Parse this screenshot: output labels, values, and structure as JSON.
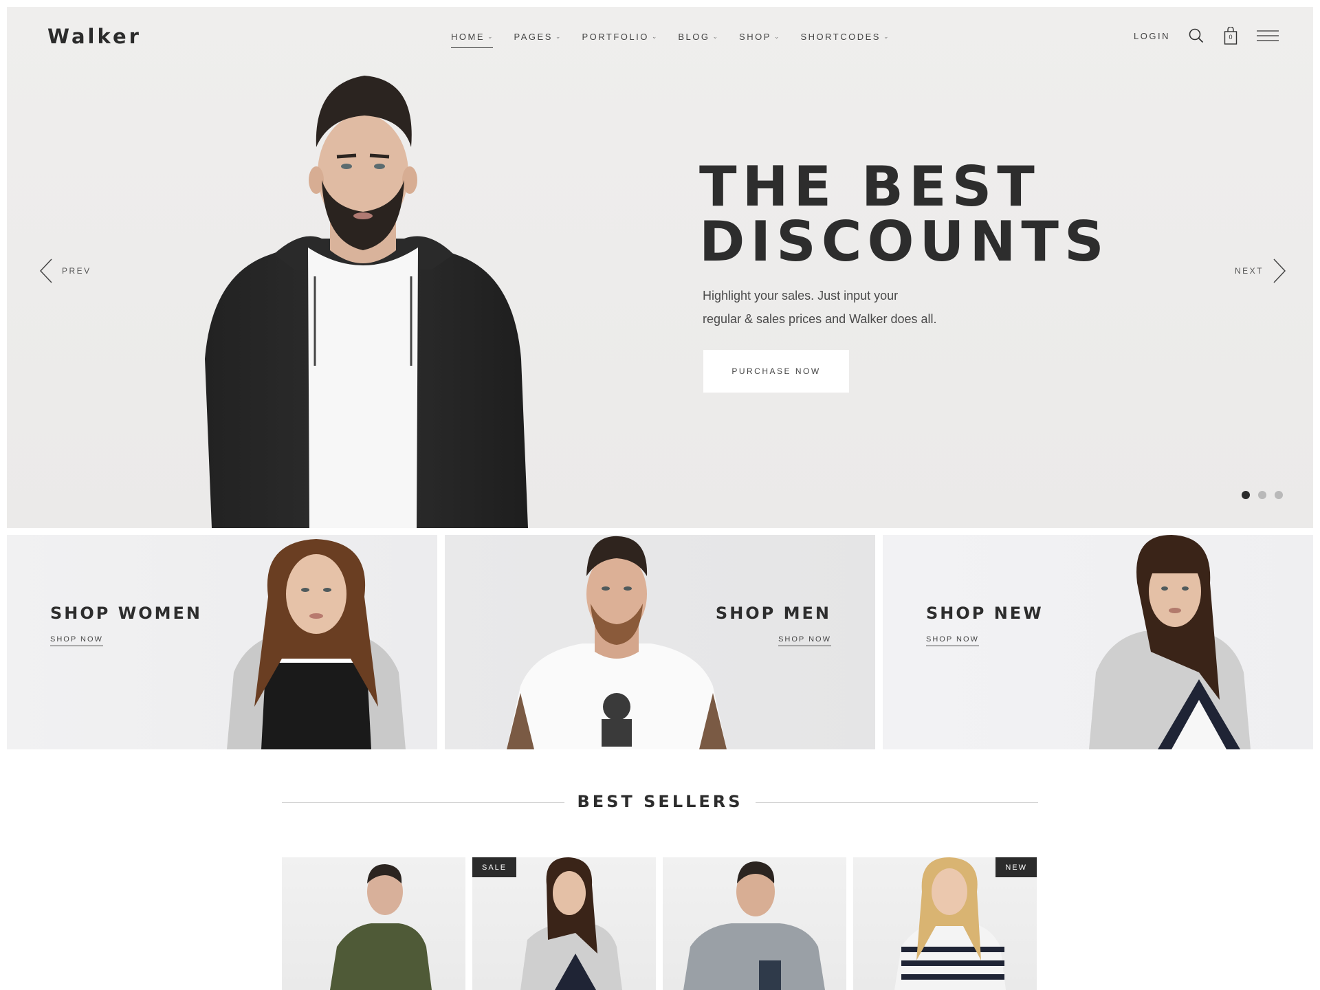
{
  "header": {
    "logo": "Walker",
    "nav": [
      {
        "label": "HOME",
        "active": true
      },
      {
        "label": "PAGES",
        "active": false
      },
      {
        "label": "PORTFOLIO",
        "active": false
      },
      {
        "label": "BLOG",
        "active": false
      },
      {
        "label": "SHOP",
        "active": false
      },
      {
        "label": "SHORTCODES",
        "active": false
      }
    ],
    "login": "LOGIN",
    "cart_count": "0",
    "icons": [
      "search-icon",
      "shopping-bag-icon",
      "hamburger-menu-icon",
      "chevron-down-icon"
    ]
  },
  "hero": {
    "headline_line1": "THE BEST",
    "headline_line2": "DISCOUNTS",
    "text_line1": "Highlight your sales. Just input your",
    "text_line2": "regular & sales prices and Walker does all.",
    "cta": "PURCHASE NOW",
    "prev": "PREV",
    "next": "NEXT",
    "slides": 3,
    "active_slide": 1
  },
  "banners": [
    {
      "title": "SHOP WOMEN",
      "link": "SHOP NOW"
    },
    {
      "title": "SHOP MEN",
      "link": "SHOP NOW"
    },
    {
      "title": "SHOP NEW",
      "link": "SHOP NOW"
    }
  ],
  "best_sellers": {
    "title": "BEST SELLERS",
    "products": [
      {
        "badge": ""
      },
      {
        "badge": "SALE"
      },
      {
        "badge": ""
      },
      {
        "badge": "NEW"
      }
    ]
  },
  "colors": {
    "text_dark": "#2d2d2d",
    "hero_bg": "#ecebea",
    "badge_bg": "#2b2b2b",
    "button_bg": "#ffffff"
  }
}
